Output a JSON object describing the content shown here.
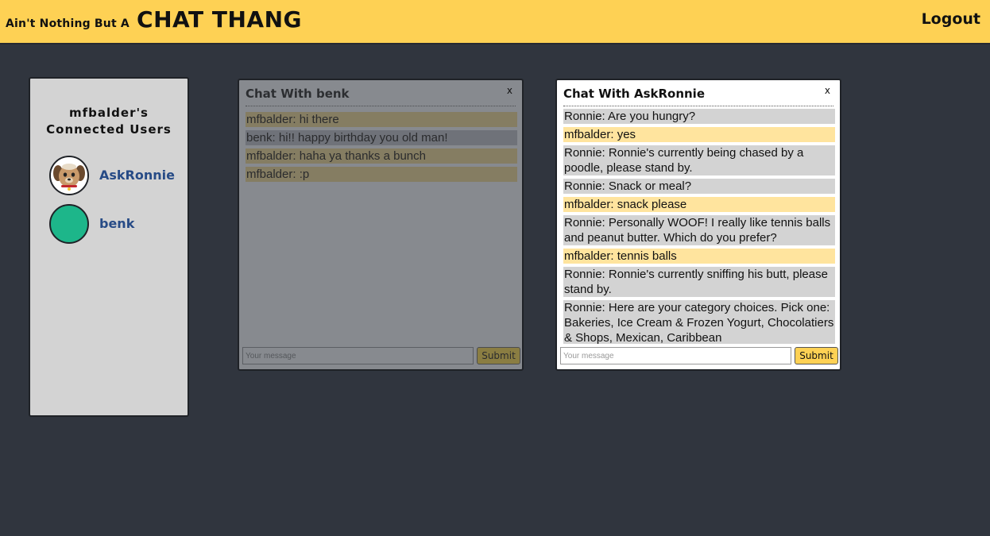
{
  "header": {
    "brand_small": "Ain't Nothing But A",
    "brand_big": "CHAT THANG",
    "logout_label": "Logout"
  },
  "users_panel": {
    "title_line1": "mfbalder's",
    "title_line2": "Connected Users",
    "users": [
      {
        "name": "AskRonnie",
        "avatar": "dog-avatar-icon"
      },
      {
        "name": "benk",
        "avatar": "green-circle-avatar",
        "color": "#1db68a"
      }
    ]
  },
  "chats": [
    {
      "title": "Chat With benk",
      "close_label": "x",
      "state": "dimmed",
      "messages": [
        {
          "text": "mfbalder: hi there",
          "from": "me"
        },
        {
          "text": "benk: hi!! happy birthday you old man!",
          "from": "them"
        },
        {
          "text": "mfbalder: haha ya thanks a bunch",
          "from": "me"
        },
        {
          "text": "mfbalder: :p",
          "from": "me"
        }
      ],
      "input_placeholder": "Your message",
      "submit_label": "Submit"
    },
    {
      "title": "Chat With AskRonnie",
      "close_label": "x",
      "state": "active",
      "messages": [
        {
          "text": "Ronnie: Are you hungry?",
          "from": "them"
        },
        {
          "text": "mfbalder: yes",
          "from": "me"
        },
        {
          "text": "Ronnie: Ronnie's currently being chased by a poodle, please stand by.",
          "from": "them"
        },
        {
          "text": "Ronnie: Snack or meal?",
          "from": "them"
        },
        {
          "text": "mfbalder: snack please",
          "from": "me"
        },
        {
          "text": "Ronnie: Personally WOOF! I really like tennis balls and peanut butter. Which do you prefer?",
          "from": "them"
        },
        {
          "text": "mfbalder: tennis balls",
          "from": "me"
        },
        {
          "text": "Ronnie: Ronnie's currently sniffing his butt, please stand by.",
          "from": "them"
        },
        {
          "text": "Ronnie: Here are your category choices. Pick one: Bakeries, Ice Cream & Frozen Yogurt, Chocolatiers & Shops, Mexican, Caribbean",
          "from": "them"
        }
      ],
      "input_placeholder": "Your message",
      "submit_label": "Submit"
    }
  ],
  "colors": {
    "header_bg": "#fed154",
    "page_bg": "#30353e",
    "panel_bg": "#d3d3d3",
    "my_message_bg": "#ffe49e",
    "their_message_bg": "#d3d3d3",
    "user_link": "#274b86"
  }
}
